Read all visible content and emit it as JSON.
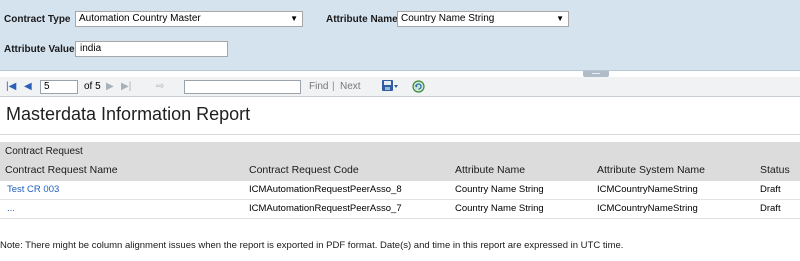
{
  "params": {
    "contract_type_label": "Contract Type",
    "contract_type_value": "Automation Country Master",
    "attribute_name_label": "Attribute Name",
    "attribute_name_value": "Country Name String",
    "attribute_value_label": "Attribute Value",
    "attribute_value_value": "india"
  },
  "toolbar": {
    "page_current": "5",
    "page_of": "of 5",
    "find_label": "Find",
    "separator": "|",
    "next_label": "Next",
    "export_icon": "save-disk-icon",
    "refresh_icon": "refresh-icon"
  },
  "report": {
    "title": "Masterdata Information Report",
    "group_title": "Contract Request",
    "columns": [
      "Contract Request Name",
      "Contract Request Code",
      "Attribute Name",
      "Attribute System Name",
      "Status"
    ],
    "rows": [
      [
        "Test CR 003",
        "ICMAutomationRequestPeerAsso_8",
        "Country Name String",
        "ICMCountryNameString",
        "Draft"
      ],
      [
        "...",
        "ICMAutomationRequestPeerAsso_7",
        "Country Name String",
        "ICMCountryNameString",
        "Draft"
      ]
    ],
    "note": "Note: There might be column alignment issues when the report is exported in PDF format. Date(s) and time in this report are expressed in UTC time."
  },
  "colors": {
    "param_bg": "#d5e3ef",
    "toolbar_bg": "#f0f2f4",
    "group_bg": "#dcdcdc",
    "link": "#1f5fbf"
  }
}
